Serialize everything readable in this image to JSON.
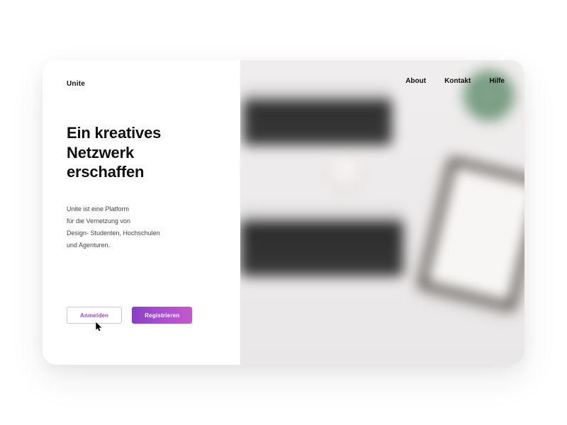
{
  "brand": {
    "name": "Unite"
  },
  "nav": {
    "about": "About",
    "contact": "Kontakt",
    "help": "Hilfe"
  },
  "hero": {
    "headline_l1": "Ein kreatives",
    "headline_l2": "Netzwerk",
    "headline_l3": "erschaffen",
    "sub_l1": "Unite ist eine Platform",
    "sub_l2": "für die Vernetzung von",
    "sub_l3": "Design- Studenten, Hochschulen",
    "sub_l4": "und Agenturen."
  },
  "cta": {
    "login": "Anmelden",
    "register": "Registrieren"
  },
  "colors": {
    "accent_start": "#8a3fbf",
    "accent_end": "#c558c9",
    "text": "#111111"
  }
}
